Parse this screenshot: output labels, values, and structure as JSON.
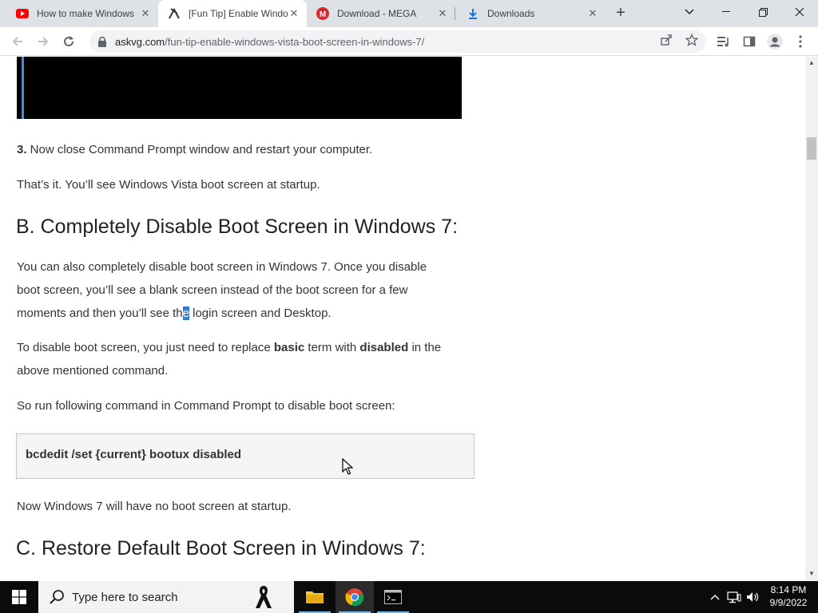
{
  "browser": {
    "tabs": [
      {
        "title": "How to make Windows",
        "icon": "youtube-icon",
        "active": false
      },
      {
        "title": "[Fun Tip] Enable Windo",
        "icon": "askvg-icon",
        "active": true
      },
      {
        "title": "Download - MEGA",
        "icon": "mega-icon",
        "active": false
      },
      {
        "title": "Downloads",
        "icon": "download-icon",
        "active": false
      }
    ],
    "new_tab": "+",
    "address": {
      "host": "askvg.com",
      "path": "/fun-tip-enable-windows-vista-boot-screen-in-windows-7/"
    }
  },
  "article": {
    "step3_num": "3.",
    "step3_text": " Now close Command Prompt window and restart your computer.",
    "thats_it": "That’s it. You’ll see Windows Vista boot screen at startup.",
    "heading_b": "B. Completely Disable Boot Screen in Windows 7:",
    "para1_line1": "You can also completely disable boot screen in Windows 7. Once you disable",
    "para1_line2": "boot screen, you’ll see a blank screen instead of the boot screen for a few",
    "para1_line3_pre": "moments and then you’ll see th",
    "para1_line3_hl": "e",
    "para1_line3_post": " login screen and Desktop.",
    "para2_pre": "To disable boot screen, you just need to replace ",
    "para2_b1": "basic",
    "para2_mid": " term with ",
    "para2_b2": "disabled",
    "para2_post": " in the",
    "para2_line2": "above mentioned command.",
    "run_following": "So run following command in Command Prompt to disable boot screen:",
    "command": "bcdedit /set {current} bootux disabled",
    "no_boot": "Now Windows 7 will have no boot screen at startup.",
    "heading_c": "C. Restore Default Boot Screen in Windows 7:"
  },
  "taskbar": {
    "search_placeholder": "Type here to search",
    "time": "8:14 PM",
    "date": "9/9/2022"
  },
  "colors": {
    "accent_blue": "#2f7de1",
    "tab_strip": "#dee1e6",
    "taskbar": "#0b0b0b"
  }
}
